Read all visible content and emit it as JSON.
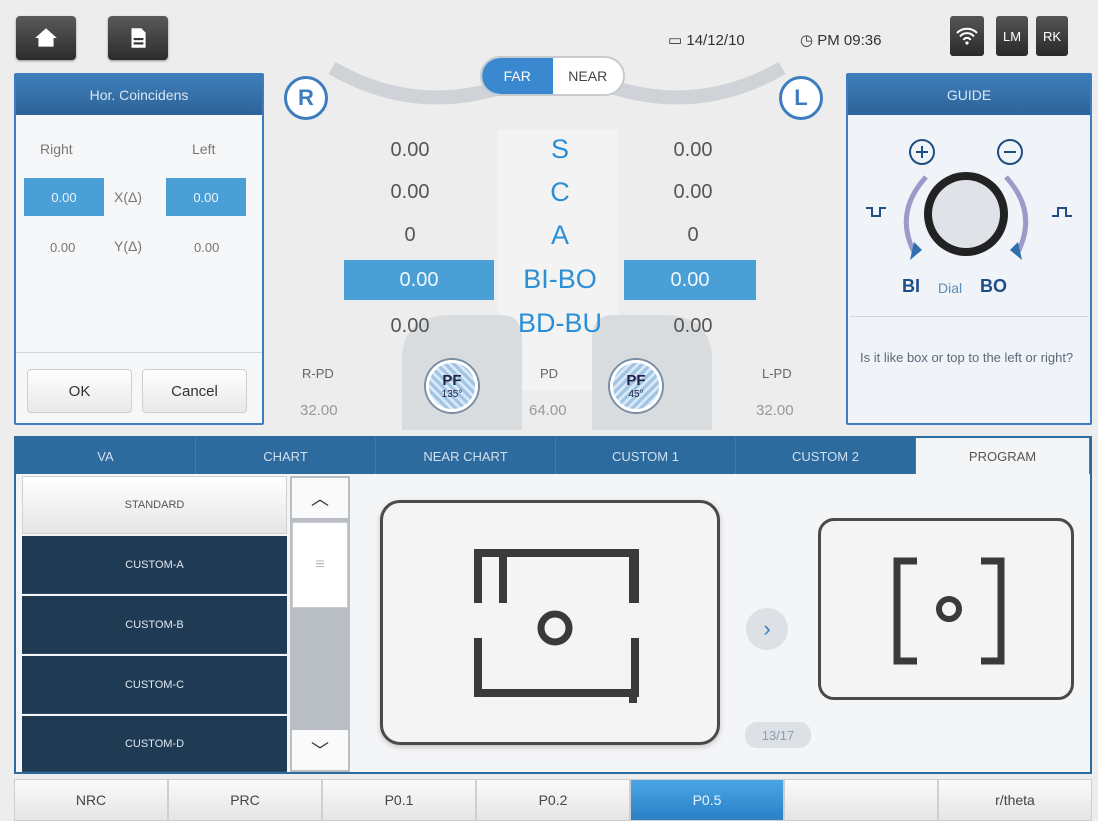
{
  "topbar": {
    "date": "14/12/10",
    "time": "PM 09:36",
    "lm": "LM",
    "rk": "RK"
  },
  "toggle": {
    "far": "FAR",
    "near": "NEAR"
  },
  "left_panel": {
    "title": "Hor. Coincidens",
    "right_label": "Right",
    "left_label": "Left",
    "x_label": "X(Δ)",
    "y_label": "Y(Δ)",
    "x_right": "0.00",
    "x_left": "0.00",
    "y_right": "0.00",
    "y_left": "0.00",
    "ok": "OK",
    "cancel": "Cancel"
  },
  "center": {
    "r_badge": "R",
    "l_badge": "L",
    "labels": [
      "S",
      "C",
      "A",
      "BI-BO",
      "BD-BU"
    ],
    "right_values": [
      "0.00",
      "0.00",
      "0",
      "0.00",
      "0.00"
    ],
    "left_values": [
      "0.00",
      "0.00",
      "0",
      "0.00",
      "0.00"
    ],
    "r_pd_label": "R-PD",
    "r_pd": "32.00",
    "pd_label": "PD",
    "pd": "64.00",
    "l_pd_label": "L-PD",
    "l_pd": "32.00",
    "pf_right": {
      "label": "PF",
      "angle": "135°"
    },
    "pf_left": {
      "label": "PF",
      "angle": "45°"
    }
  },
  "guide": {
    "title": "GUIDE",
    "bi": "BI",
    "dial": "Dial",
    "bo": "BO",
    "question": "Is it like box or top to the left or right?"
  },
  "tabs": [
    "VA",
    "CHART",
    "NEAR CHART",
    "CUSTOM 1",
    "CUSTOM 2",
    "PROGRAM"
  ],
  "list": [
    "STANDARD",
    "CUSTOM-A",
    "CUSTOM-B",
    "CUSTOM-C",
    "CUSTOM-D"
  ],
  "page_indicator": "13/17",
  "bottom": [
    "NRC",
    "PRC",
    "P0.1",
    "P0.2",
    "P0.5",
    "",
    "r/theta"
  ],
  "colors": {
    "accent": "#3d7dbf",
    "highlight": "#4aa0d6",
    "dark_list": "#1f3b54"
  }
}
